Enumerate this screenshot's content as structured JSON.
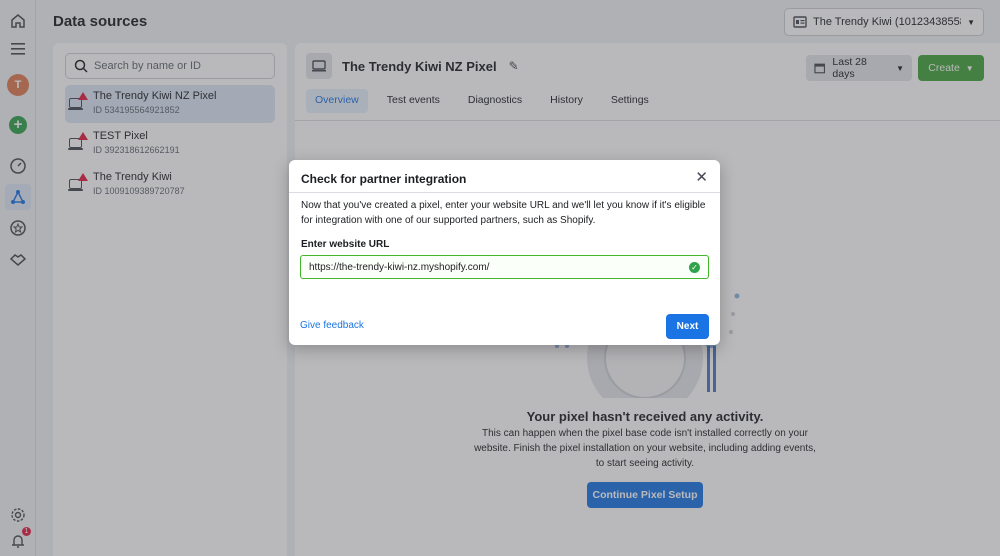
{
  "header": {
    "title": "Data sources",
    "account_selector": "The Trendy Kiwi (101234385587..."
  },
  "rail": {
    "avatar_letter": "T",
    "notification_count": "1"
  },
  "search": {
    "placeholder": "Search by name or ID"
  },
  "sources": [
    {
      "name": "The Trendy Kiwi NZ Pixel",
      "id": "ID 534195564921852",
      "selected": true,
      "warning": true
    },
    {
      "name": "TEST Pixel",
      "id": "ID 392318612662191",
      "selected": false,
      "warning": true
    },
    {
      "name": "The Trendy Kiwi",
      "id": "ID 1009109389720787",
      "selected": false,
      "warning": true
    }
  ],
  "main": {
    "pixel_name": "The Trendy Kiwi NZ Pixel",
    "date_range": "Last 28 days",
    "create_label": "Create",
    "tabs": [
      "Overview",
      "Test events",
      "Diagnostics",
      "History",
      "Settings"
    ],
    "active_tab": "Overview",
    "empty_title": "Your pixel hasn't received any activity.",
    "empty_desc": "This can happen when the pixel base code isn't installed correctly on your website. Finish the pixel installation on your website, including adding events, to start seeing activity.",
    "setup_button": "Continue Pixel Setup"
  },
  "modal": {
    "title": "Check for partner integration",
    "description": "Now that you've created a pixel, enter your website URL and we'll let you know if it's eligible for integration with one of our supported partners, such as Shopify.",
    "url_label": "Enter website URL",
    "url_value": "https://the-trendy-kiwi-nz.myshopify.com/",
    "feedback_link": "Give feedback",
    "next_button": "Next"
  },
  "colors": {
    "accent": "#1b74e4",
    "create_green": "#42a33a",
    "warning_red": "#e41e3f"
  }
}
